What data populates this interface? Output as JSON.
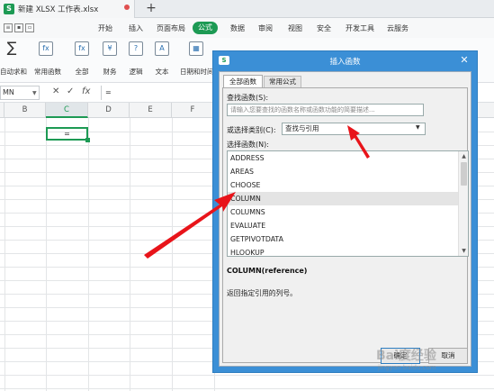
{
  "app": {
    "file_title": "新建 XLSX 工作表.xlsx",
    "file_icon_letter": "S"
  },
  "menu": {
    "items": [
      "开始",
      "插入",
      "页面布局",
      "公式",
      "数据",
      "审阅",
      "视图",
      "安全",
      "开发工具",
      "云服务"
    ],
    "active": "公式"
  },
  "ribbon": {
    "buttons": [
      {
        "label": "自动求和",
        "icon": "sum-icon"
      },
      {
        "label": "常用函数",
        "icon": "fx-icon"
      },
      {
        "label": "全部",
        "icon": "fx-icon"
      },
      {
        "label": "财务",
        "icon": "finance-icon"
      },
      {
        "label": "逻辑",
        "icon": "logic-icon"
      },
      {
        "label": "文本",
        "icon": "text-icon"
      },
      {
        "label": "日期和时间",
        "icon": "date-icon"
      }
    ]
  },
  "formula_bar": {
    "name_box": "MN",
    "fx_label": "fx",
    "value": "="
  },
  "grid": {
    "columns": [
      "B",
      "C",
      "D",
      "E",
      "F"
    ],
    "active_column": "C",
    "active_cell_value": "="
  },
  "dialog": {
    "title": "插入函数",
    "icon_letter": "S",
    "tabs": [
      "全部函数",
      "常用公式"
    ],
    "search_label": "查找函数(S):",
    "search_placeholder": "请输入您要查找的函数名称或函数功能的简要描述...",
    "category_label": "或选择类别(C):",
    "category_value": "查找与引用",
    "function_list_label": "选择函数(N):",
    "functions": [
      "ADDRESS",
      "AREAS",
      "CHOOSE",
      "COLUMN",
      "COLUMNS",
      "EVALUATE",
      "GETPIVOTDATA",
      "HLOOKUP"
    ],
    "selected_function": "COLUMN",
    "signature": "COLUMN(reference)",
    "description": "返回指定引用的列号。",
    "ok_label": "确定",
    "cancel_label": "取消"
  },
  "colors": {
    "accent": "#1d9a54",
    "dialog_title_bar": "#3b8fd6",
    "arrow": "#e8141a"
  },
  "watermark": {
    "text": "Bai度经验",
    "sub": "jingyan.baidu.com"
  }
}
